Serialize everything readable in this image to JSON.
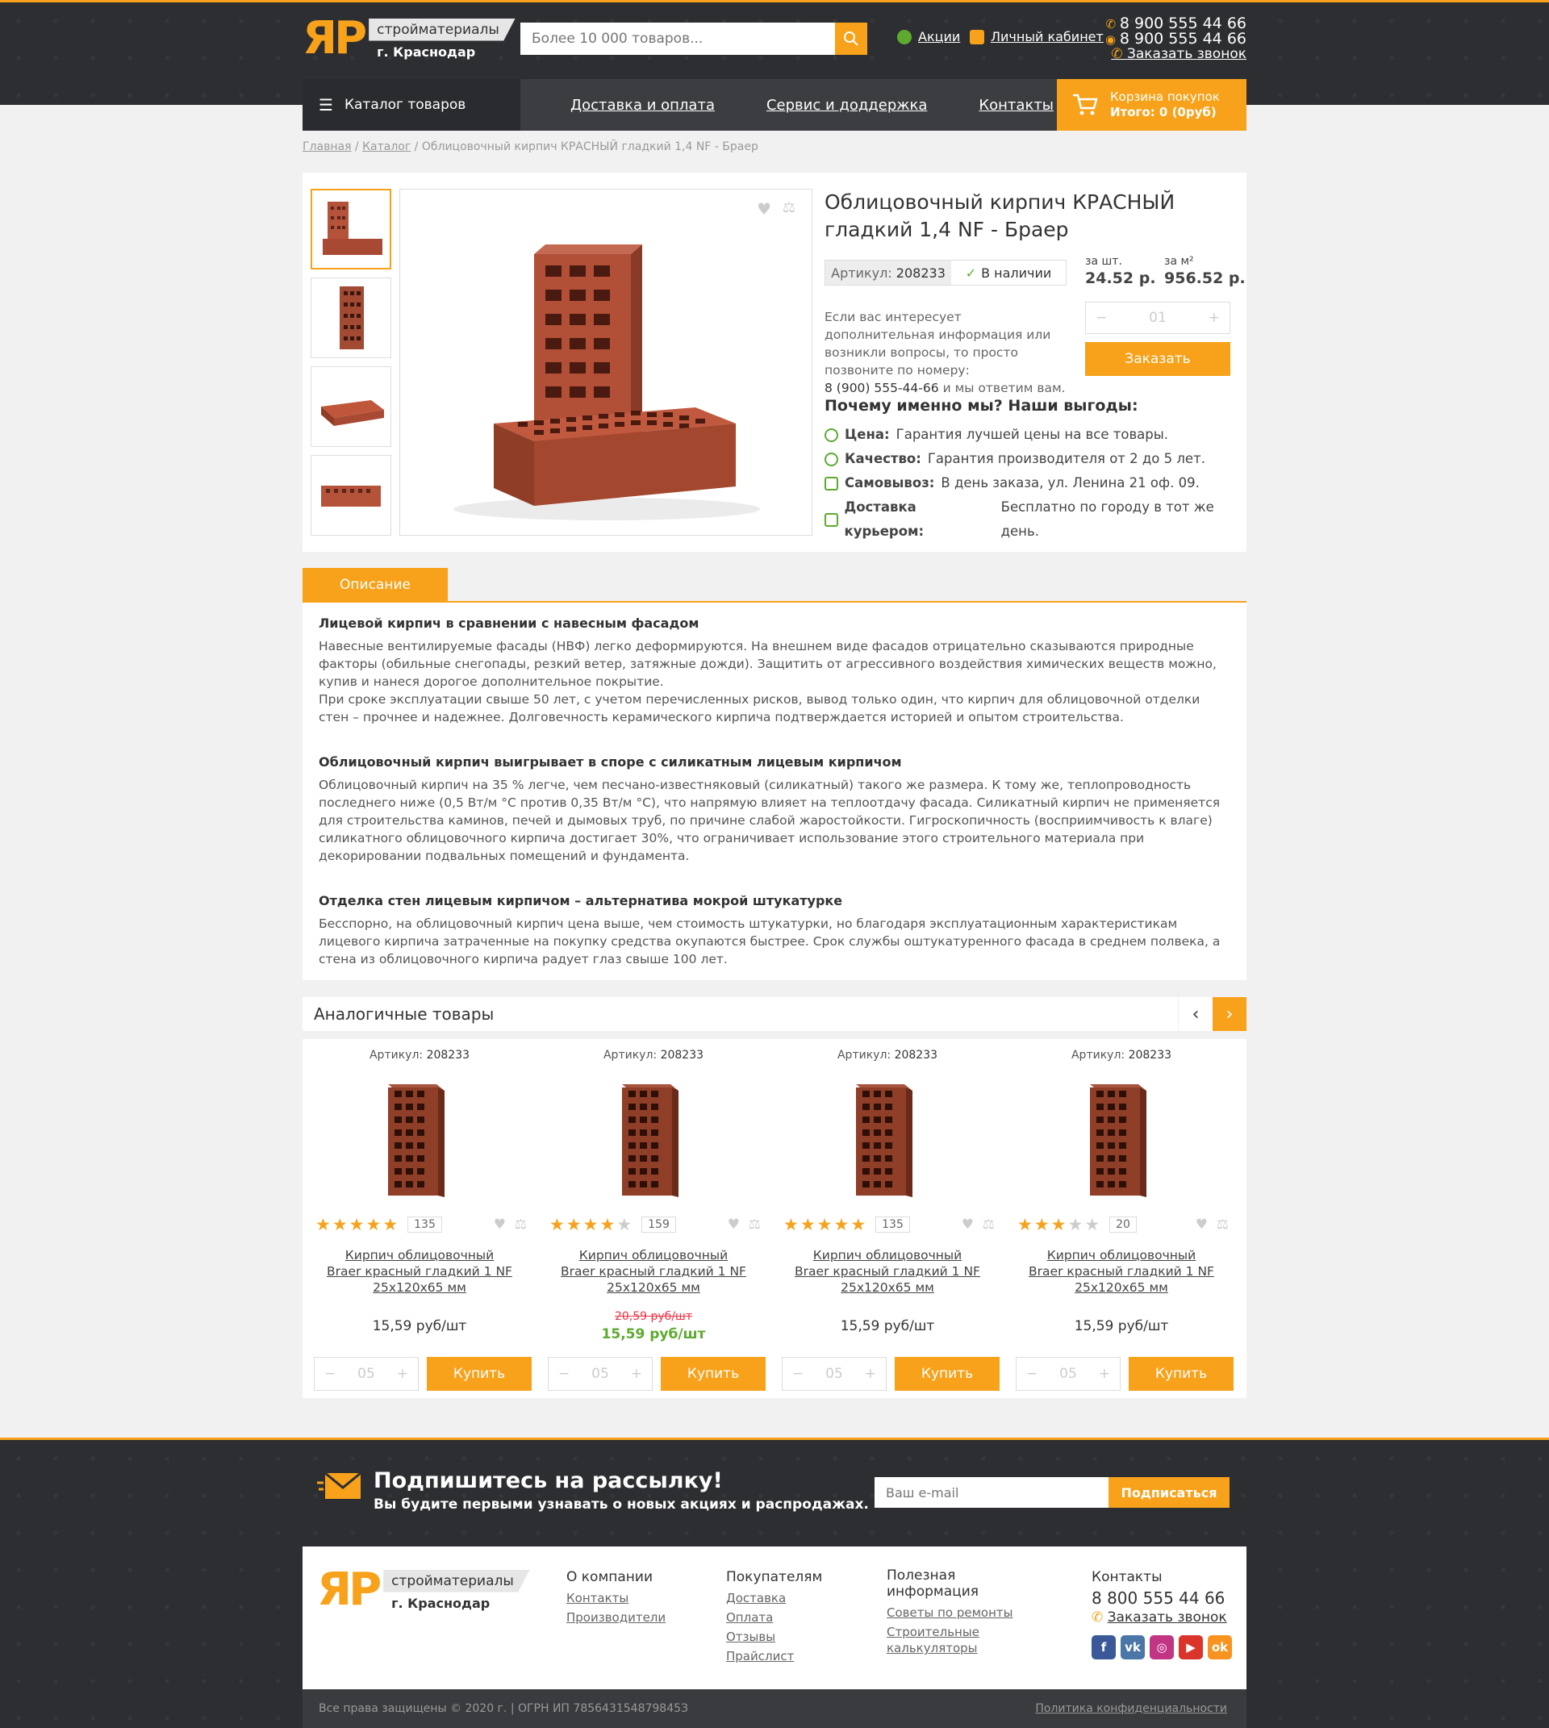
{
  "header": {
    "logo": "ЯР",
    "logo_tag": "стройматериалы",
    "city": "г. Краснодар",
    "search_placeholder": "Более 10 000 товаров...",
    "promo_link": "Акции",
    "account_link": "Личный кабинет",
    "phone1": "8 900 555 44 66",
    "phone2": "8 900 555 44 66",
    "callback": "Заказать звонок"
  },
  "menu": {
    "catalog": "Каталог товаров",
    "items": [
      "Доставка и оплата",
      "Сервис и доддержка",
      "Контакты"
    ],
    "cart_title": "Корзина покупок",
    "cart_total": "Итого: 0 (0руб)"
  },
  "breadcrumb": {
    "home": "Главная",
    "catalog": "Каталог",
    "current": "Облицовочный кирпич КРАСНЫЙ гладкий 1,4 NF - Браер"
  },
  "product": {
    "title": "Облицовочный кирпич КРАСНЫЙ гладкий 1,4 NF - Браер",
    "sku_label": "Артикул:",
    "sku": "208233",
    "stock": "В наличии",
    "per_piece_label": "за шт.",
    "per_piece_price": "24.52 р.",
    "per_m2_label": "за м²",
    "per_m2_price": "956.52 р.",
    "info": "Если вас интересует дополнительная информация или возникли вопросы, то просто позвоните по номеру:",
    "info_phone": "8 (900) 555-44-66",
    "info_end": "и мы ответим вам.",
    "qty": "01",
    "order_button": "Заказать",
    "why_title": "Почему именно мы? Наши выгоды:",
    "benefits": [
      {
        "label": "Цена:",
        "text": "Гарантия лучшей цены на все товары."
      },
      {
        "label": "Качество:",
        "text": "Гарантия производителя от 2 до 5 лет."
      },
      {
        "label": "Самовывоз:",
        "text": "В день заказа, ул. Ленина 21 оф. 09."
      },
      {
        "label": "Доставка курьером:",
        "text": "Бесплатно по городу в тот же день."
      }
    ]
  },
  "description": {
    "tab": "Описание",
    "h1": "Лицевой кирпич в сравнении с навесным фасадом",
    "p1": "Навесные вентилируемые фасады (НВФ) легко деформируются. На внешнем виде фасадов отрицательно сказываются природные факторы (обильные снегопады, резкий ветер, затяжные дожди). Защитить от агрессивного воздействия химических веществ можно, купив и нанеся дорогое дополнительное покрытие.",
    "p1b": "При сроке эксплуатации свыше 50 лет, с учетом перечисленных рисков, вывод только один, что кирпич для облицовочной отделки стен – прочнее и надежнее. Долговечность керамического кирпича подтверждается историей и опытом строительства.",
    "h2": "Облицовочный кирпич выигрывает в споре с силикатным лицевым кирпичом",
    "p2": "Облицовочный кирпич на 35 % легче, чем песчано-известняковый (силикатный) такого же размера. К тому же, теплопроводность последнего ниже (0,5 Вт/м °С против 0,35 Вт/м °С), что напрямую влияет на теплоотдачу фасада. Силикатный кирпич не применяется для строительства каминов, печей и дымовых труб, по причине слабой жаростойкости. Гигроскопичность (восприимчивость к влаге) силикатного облицовочного кирпича достигает 30%, что ограничивает использование этого строительного материала при декорировании подвальных помещений и фундамента.",
    "h3": "Отделка стен лицевым кирпичом – альтернатива мокрой штукатурке",
    "p3": "Бесспорно, на облицовочный кирпич цена выше, чем стоимость штукатурки, но благодаря эксплуатационным характеристикам лицевого кирпича затраченные на покупку средства окупаются быстрее. Срок службы оштукатуренного фасада в среднем полвека, а стена из облицовочного кирпича радует глаз свыше 100 лет."
  },
  "similar": {
    "title": "Аналогичные товары",
    "products": [
      {
        "sku_label": "Артикул:",
        "sku": "208233",
        "rating": 5,
        "count": "135",
        "name1": "Кирпич облицовочный",
        "name2": "Braer красный гладкий 1 NF",
        "name3": "25х120х65 мм",
        "price": "15,59 руб/шт",
        "old_price": "",
        "qty": "05",
        "button": "Купить"
      },
      {
        "sku_label": "Артикул:",
        "sku": "208233",
        "rating": 4,
        "count": "159",
        "name1": "Кирпич облицовочный",
        "name2": "Braer красный гладкий 1 NF",
        "name3": "25х120х65 мм",
        "price": "15,59 руб/шт",
        "old_price": "20,59 руб/шт",
        "qty": "05",
        "button": "Купить"
      },
      {
        "sku_label": "Артикул:",
        "sku": "208233",
        "rating": 5,
        "count": "135",
        "name1": "Кирпич облицовочный",
        "name2": "Braer красный гладкий 1 NF",
        "name3": "25х120х65 мм",
        "price": "15,59 руб/шт",
        "old_price": "",
        "qty": "05",
        "button": "Купить"
      },
      {
        "sku_label": "Артикул:",
        "sku": "208233",
        "rating": 3,
        "count": "20",
        "name1": "Кирпич облицовочный",
        "name2": "Braer красный гладкий 1 NF",
        "name3": "25х120х65 мм",
        "price": "15,59 руб/шт",
        "old_price": "",
        "qty": "05",
        "button": "Купить"
      }
    ]
  },
  "newsletter": {
    "title": "Подпишитесь на рассылку!",
    "subtitle": "Вы будите первыми узнавать о новых акциях и распродажах.",
    "placeholder": "Ваш e-mail",
    "button": "Подписаться"
  },
  "footer": {
    "col1_title": "О компании",
    "col1": [
      "Контакты",
      "Производители"
    ],
    "col2_title": "Покупателям",
    "col2": [
      "Доставка",
      "Оплата",
      "Отзывы",
      "Прайслист"
    ],
    "col3_title": "Полезная информация",
    "col3": [
      "Советы по ремонты",
      "Строительные калькуляторы"
    ],
    "col4_title": "Контакты",
    "phone": "8 800 555 44 66",
    "callback": "Заказать звонок",
    "copyright": "Все права защищены © 2020 г. | ОГРН ИП 785643154879845З",
    "privacy": "Политика конфиденциальности"
  },
  "colors": {
    "accent": "#f7a21a",
    "dark": "#2d2e31",
    "green": "#5eaa2f"
  }
}
